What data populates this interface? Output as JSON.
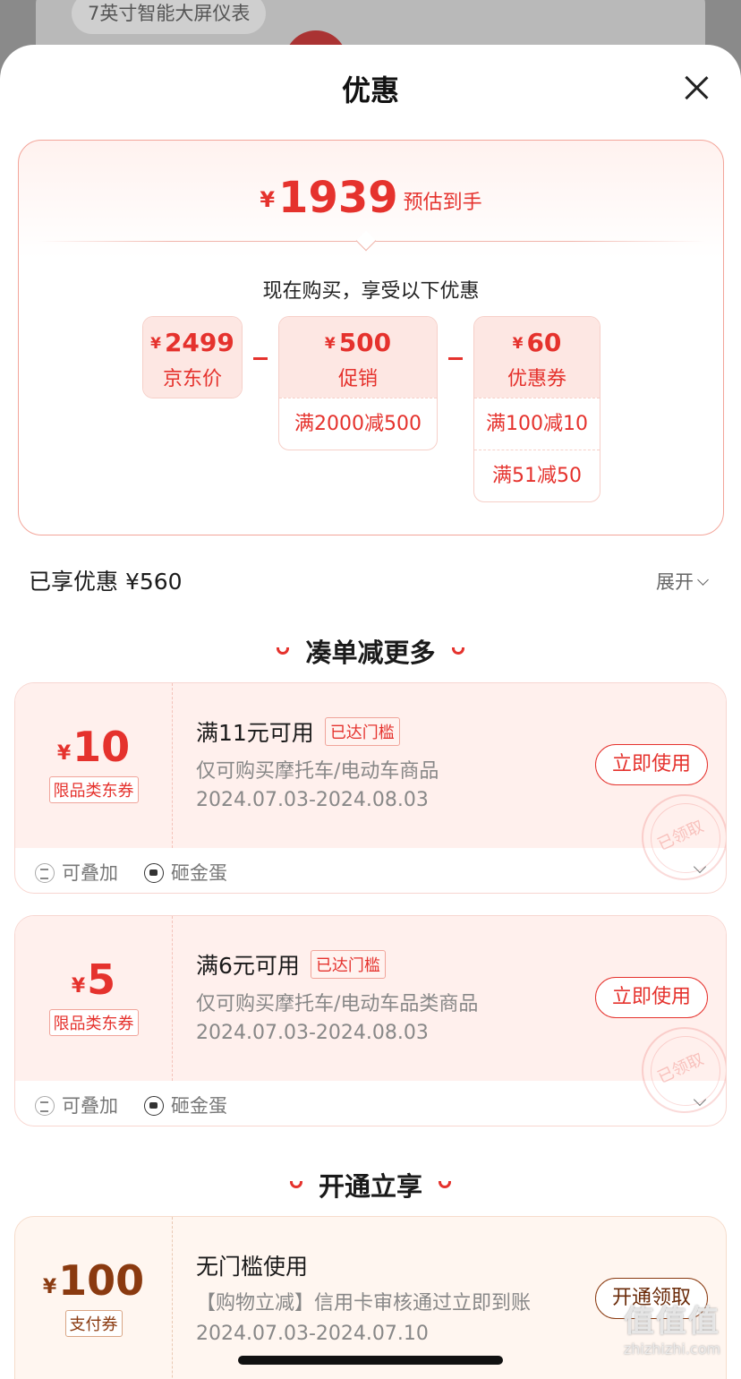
{
  "background": {
    "banner_chip": "7英寸智能大屏仪表"
  },
  "sheet": {
    "title": "优惠"
  },
  "summary": {
    "currency": "¥",
    "estimated_price": "1939",
    "estimated_label": "预估到手",
    "subtitle": "现在购买，享受以下优惠",
    "jd_price": {
      "value": "2499",
      "label": "京东价"
    },
    "promotion": {
      "value": "500",
      "label": "促销",
      "rules": [
        "满2000减500"
      ]
    },
    "coupon": {
      "value": "60",
      "label": "优惠券",
      "rules": [
        "满100减10",
        "满51减50"
      ]
    }
  },
  "saved": {
    "text": "已享优惠 ¥560",
    "expand_label": "展开"
  },
  "section_more": {
    "title": "凑单减更多"
  },
  "coupons": [
    {
      "currency": "¥",
      "amount": "10",
      "tag": "限品类东券",
      "title": "满11元可用",
      "badge": "已达门槛",
      "desc": "仅可购买摩托车/电动车商品",
      "date": "2024.07.03-2024.08.03",
      "button": "立即使用",
      "stamp": "已领取",
      "feature_1": "可叠加",
      "feature_2": "砸金蛋"
    },
    {
      "currency": "¥",
      "amount": "5",
      "tag": "限品类东券",
      "title": "满6元可用",
      "badge": "已达门槛",
      "desc": "仅可购买摩托车/电动车品类商品",
      "date": "2024.07.03-2024.08.03",
      "button": "立即使用",
      "stamp": "已领取",
      "feature_1": "可叠加",
      "feature_2": "砸金蛋"
    }
  ],
  "section_open": {
    "title": "开通立享"
  },
  "pay_coupon": {
    "currency": "¥",
    "amount": "100",
    "tag": "支付券",
    "title": "无门槛使用",
    "desc": "【购物立减】信用卡审核通过立即到账",
    "date": "2024.07.03-2024.07.10",
    "button": "开通领取"
  },
  "watermark": {
    "logo": "值值值",
    "site": "zhizhizhi.com"
  },
  "colors": {
    "accent": "#e5322d",
    "coupon_bg": "#fff0ed",
    "pay_accent": "#8a3a10"
  }
}
